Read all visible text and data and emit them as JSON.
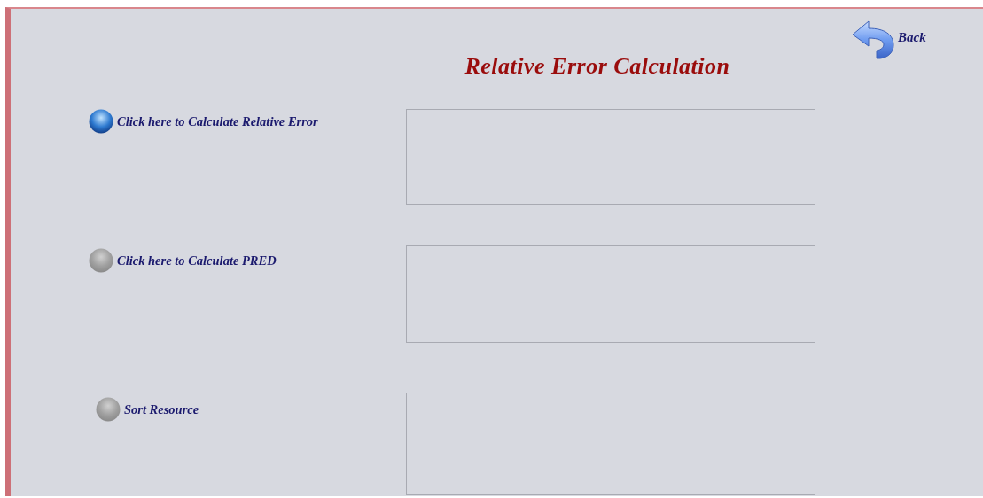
{
  "title": "Relative Error Calculation",
  "back_button": {
    "label": "Back"
  },
  "options": [
    {
      "label": "Click here to Calculate Relative Error",
      "selected": true
    },
    {
      "label": "Click here to Calculate PRED",
      "selected": false
    },
    {
      "label": "Sort Resource",
      "selected": false
    }
  ]
}
